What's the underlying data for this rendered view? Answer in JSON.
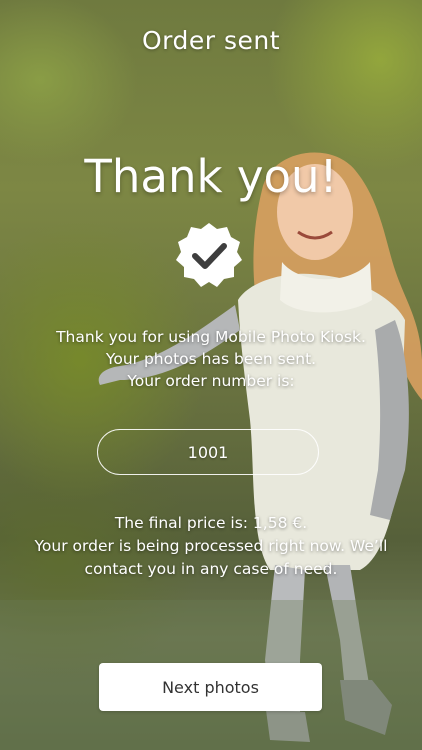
{
  "header": {
    "title": "Order sent"
  },
  "main": {
    "heading": "Thank you!",
    "badge_icon": "checkmark-badge-icon",
    "message_lines": [
      "Thank you for using Mobile Photo Kiosk.",
      "Your photos has been sent.",
      "Your order number is:"
    ],
    "order_number": "1001",
    "final_lines": [
      "The final price is: 1,58 €.",
      "Your order is being processed right now. We’ll",
      "contact you in any case of need."
    ]
  },
  "footer": {
    "next_button_label": "Next photos"
  },
  "colors": {
    "text": "#ffffff",
    "button_bg": "#ffffff",
    "button_text": "#333333"
  }
}
